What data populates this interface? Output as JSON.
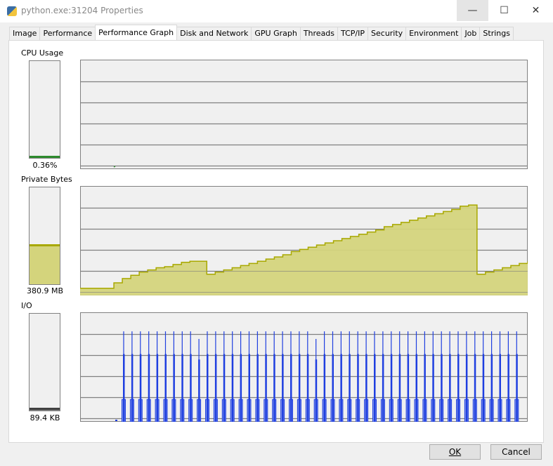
{
  "window": {
    "title": "python.exe:31204 Properties",
    "minimize": "—",
    "maximize": "☐",
    "close": "✕"
  },
  "tabs": [
    {
      "label": "Image"
    },
    {
      "label": "Performance"
    },
    {
      "label": "Performance Graph",
      "active": true
    },
    {
      "label": "Disk and Network"
    },
    {
      "label": "GPU Graph"
    },
    {
      "label": "Threads"
    },
    {
      "label": "TCP/IP"
    },
    {
      "label": "Security"
    },
    {
      "label": "Environment"
    },
    {
      "label": "Job"
    },
    {
      "label": "Strings"
    }
  ],
  "cpu": {
    "label": "CPU Usage",
    "value": "0.36%",
    "meter_percent": 0.36,
    "color": "#2e8b2e"
  },
  "private_bytes": {
    "label": "Private Bytes",
    "value": "380.9 MB",
    "meter_percent": 39,
    "color": "#a8a800",
    "fill": "#d4d47c",
    "history_percent": [
      6,
      6,
      6,
      6,
      11,
      15,
      18,
      21,
      23,
      25,
      26,
      28,
      30,
      31,
      31,
      19,
      21,
      23,
      25,
      27,
      29,
      31,
      33,
      35,
      37,
      40,
      42,
      44,
      46,
      48,
      50,
      52,
      54,
      56,
      58,
      60,
      63,
      65,
      67,
      69,
      71,
      73,
      75,
      77,
      79,
      82,
      83,
      19,
      21,
      23,
      25,
      27,
      29,
      31
    ]
  },
  "io": {
    "label": "I/O",
    "value": "89.4  KB",
    "meter_percent": 1,
    "color": "#1f3fe0",
    "fill": "#8c9ee8",
    "spike_count": 48,
    "spike_peak_percent": 83,
    "spike_mid_percent": 62,
    "spike_base_percent": 20,
    "short_spikes": [
      9,
      23
    ],
    "short_peak_percent": 76,
    "short_mid_percent": 57
  },
  "buttons": {
    "ok": "OK",
    "cancel": "Cancel"
  }
}
